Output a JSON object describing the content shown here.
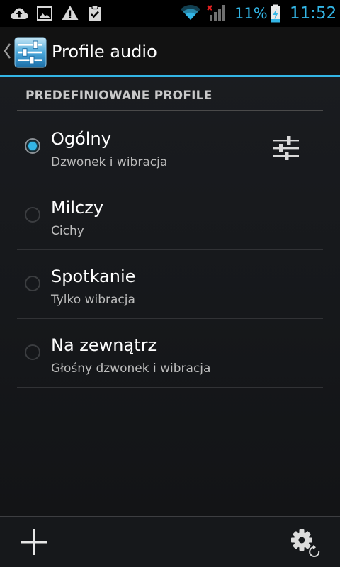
{
  "status_bar": {
    "battery_percent": "11%",
    "clock": "11:52",
    "accent_color": "#33b5e5",
    "left_icons": [
      "upload-cloud-icon",
      "gallery-image-icon",
      "warning-icon",
      "clipboard-check-icon"
    ],
    "right_icons": [
      "wifi-icon",
      "cellular-signal-no-service-icon",
      "battery-charging-icon"
    ]
  },
  "action_bar": {
    "title": "Profile audio",
    "app_icon": "equalizer-settings-icon",
    "up_icon": "up-caret-icon"
  },
  "section": {
    "header": "PREDEFINIOWANE PROFILE"
  },
  "profiles": [
    {
      "title": "Ogólny",
      "subtitle": "Dzwonek i wibracja",
      "selected": true,
      "has_settings": true
    },
    {
      "title": "Milczy",
      "subtitle": "Cichy",
      "selected": false
    },
    {
      "title": "Spotkanie",
      "subtitle": "Tylko wibracja",
      "selected": false
    },
    {
      "title": "Na zewnątrz",
      "subtitle": "Głośny dzwonek i wibracja",
      "selected": false
    }
  ],
  "bottom_bar": {
    "add_icon": "add-icon",
    "reset_icon": "settings-reset-icon"
  }
}
